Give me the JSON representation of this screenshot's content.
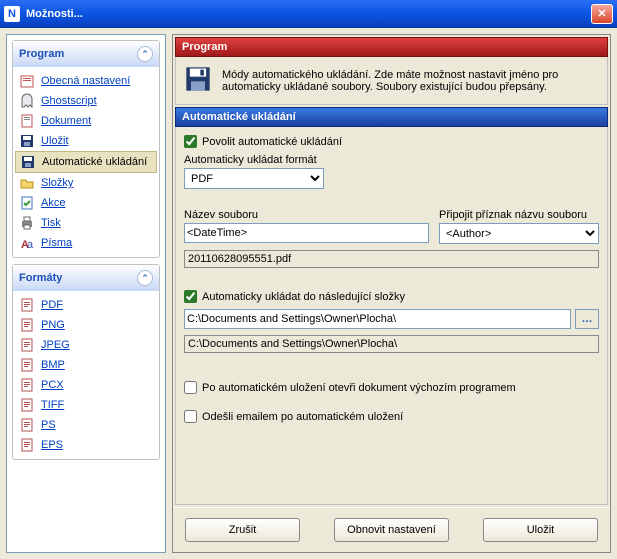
{
  "window": {
    "title": "Možnosti..."
  },
  "sidebar": {
    "program": {
      "title": "Program",
      "items": [
        {
          "label": "Obecná nastavení",
          "icon": "settings"
        },
        {
          "label": "Ghostscript",
          "icon": "ghost"
        },
        {
          "label": "Dokument",
          "icon": "doc"
        },
        {
          "label": "Uložit",
          "icon": "save"
        },
        {
          "label": "Automatické ukládání",
          "icon": "autosave",
          "active": true
        },
        {
          "label": "Složky",
          "icon": "folder"
        },
        {
          "label": "Akce",
          "icon": "action"
        },
        {
          "label": "Tisk",
          "icon": "print"
        },
        {
          "label": "Písma",
          "icon": "font"
        }
      ]
    },
    "formats": {
      "title": "Formáty",
      "items": [
        {
          "label": "PDF",
          "icon": "fmt"
        },
        {
          "label": "PNG",
          "icon": "fmt"
        },
        {
          "label": "JPEG",
          "icon": "fmt"
        },
        {
          "label": "BMP",
          "icon": "fmt"
        },
        {
          "label": "PCX",
          "icon": "fmt"
        },
        {
          "label": "TIFF",
          "icon": "fmt"
        },
        {
          "label": "PS",
          "icon": "fmt"
        },
        {
          "label": "EPS",
          "icon": "fmt"
        }
      ]
    }
  },
  "main": {
    "section_title": "Program",
    "description": "Módy automatického ukládání. Zde máte možnost nastavit jméno pro automaticky ukládané soubory. Soubory existující budou přepsány.",
    "subsection_title": "Automatické ukládání",
    "enable_label": "Povolit automatické ukládání",
    "enable_checked": true,
    "format_label": "Automaticky ukládat formát",
    "format_value": "PDF",
    "filename_label": "Název souboru",
    "filename_value": "<DateTime>",
    "suffix_label": "Připojit příznak názvu souboru",
    "suffix_value": "<Author>",
    "preview_value": "20110628095551.pdf",
    "folder_label": "Automaticky ukládat do následující složky",
    "folder_checked": true,
    "folder_value": "C:\\Documents and Settings\\Owner\\Plocha\\",
    "folder_preview": "C:\\Documents and Settings\\Owner\\Plocha\\",
    "open_after_label": "Po automatickém uložení otevři dokument výchozím programem",
    "open_after_checked": false,
    "email_after_label": "Odešli emailem po automatickém uložení",
    "email_after_checked": false
  },
  "buttons": {
    "cancel": "Zrušit",
    "refresh": "Obnovit nastavení",
    "save": "Uložit"
  }
}
